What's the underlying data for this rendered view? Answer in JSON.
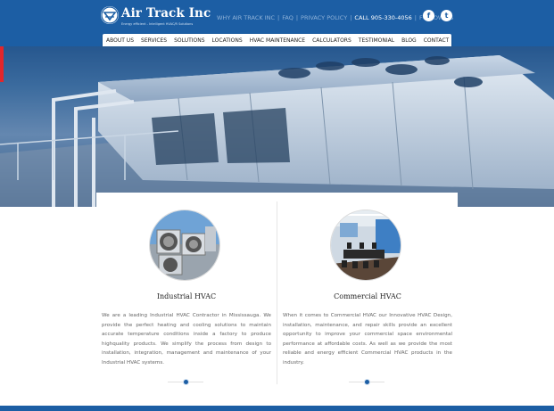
{
  "brand": {
    "name": "Air Track Inc",
    "tagline": "Energy efficient - Intelligent HVAC/R Solutions",
    "colors": {
      "primary": "#1c5ea4",
      "accent": "#e2262b"
    }
  },
  "toplinks": {
    "why": "WHY AIR TRACK INC",
    "faq": "FAQ",
    "privacy": "PRIVACY POLICY",
    "call": "CALL 905-330-4056",
    "follow": "FOLLOW US",
    "facebook_icon": "f",
    "twitter_icon": "t"
  },
  "nav": [
    "ABOUT US",
    "SERVICES",
    "SOLUTIONS",
    "LOCATIONS",
    "HVAC MAINTENANCE",
    "CALCULATORS",
    "TESTIMONIAL",
    "BLOG",
    "CONTACT"
  ],
  "cards": [
    {
      "title": "Industrial HVAC",
      "image_icon": "industrial-hvac-photo",
      "text": "We are a leading Industrial HVAC Contractor in Mississauga. We provide the perfect heating and cooling solutions to maintain accurate temperature conditions inside a factory to produce highquality products. We simplify the process from design to installation, integration, management and maintenance of your Industrial HVAC systems."
    },
    {
      "title": "Commercial HVAC",
      "image_icon": "commercial-hvac-photo",
      "text": "When it comes to Commercial HVAC our Innovative HVAC Design, installation, maintenance, and repair skills provide an excellent opportunity to improve your commercial space environmental performance at affordable costs. As well as we provide the most reliable and energy efficient Commercial HVAC products in the industry."
    }
  ]
}
